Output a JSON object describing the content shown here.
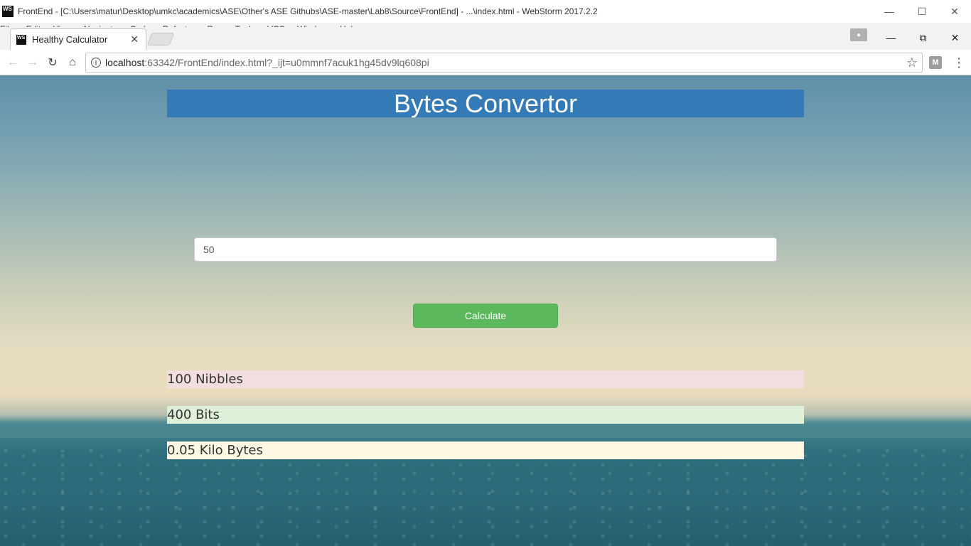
{
  "ide": {
    "logo": "WS",
    "title": "FrontEnd - [C:\\Users\\matur\\Desktop\\umkc\\academics\\ASE\\Other's ASE Githubs\\ASE-master\\Lab8\\Source\\FrontEnd] - ...\\index.html - WebStorm 2017.2.2",
    "menu": [
      "File",
      "Edit",
      "View",
      "Navigate",
      "Code",
      "Refactor",
      "Run",
      "Tools",
      "VCS",
      "Window",
      "Help"
    ]
  },
  "browser": {
    "tab_title": "Healthy Calculator",
    "url_host": "localhost",
    "url_rest": ":63342/FrontEnd/index.html?_ijt=u0mmnf7acuk1hg45dv9lq608pi",
    "extension_label": "M"
  },
  "page": {
    "heading": "Bytes Convertor",
    "input_value": "50",
    "calculate_label": "Calculate",
    "results": [
      "100 Nibbles",
      "400 Bits",
      "0.05 Kilo Bytes"
    ]
  },
  "colors": {
    "header_bg": "#337ab7",
    "button_bg": "#5cb85c",
    "result_1_bg": "#f2dede",
    "result_2_bg": "#dff0d8",
    "result_3_bg": "#fcf8e3"
  },
  "icons": [
    "webstorm-logo-icon",
    "tab-close-icon",
    "back-arrow-icon",
    "forward-arrow-icon",
    "reload-icon",
    "home-icon",
    "info-icon",
    "star-icon",
    "menu-dots-icon",
    "profile-icon"
  ]
}
